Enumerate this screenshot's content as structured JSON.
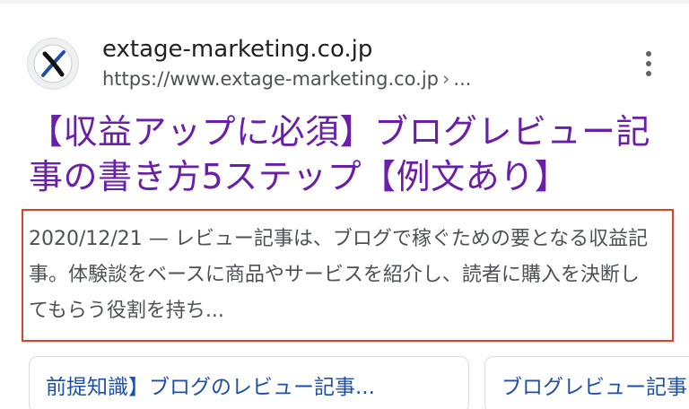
{
  "site": {
    "name": "extage-marketing.co.jp",
    "url": "https://www.extage-marketing.co.jp",
    "url_separator": "›",
    "url_tail": "...",
    "favicon_letter": "X"
  },
  "result": {
    "title": "【収益アップに必須】ブログレビュー記事の書き方5ステップ【例文あり】",
    "date": "2020/12/21",
    "dash": "—",
    "snippet": "レビュー記事は、ブログで稼ぐための要となる収益記事。体験談をベースに商品やサービスを紹介し、読者に購入を決断してもらう役割を持ち..."
  },
  "chips": [
    {
      "label": "前提知識】ブログのレビュー記事..."
    },
    {
      "label": "ブログレビュー記事"
    }
  ],
  "colors": {
    "title": "#6a1fa8",
    "highlight_border": "#d9432a",
    "chip_text": "#1f4fa8"
  }
}
